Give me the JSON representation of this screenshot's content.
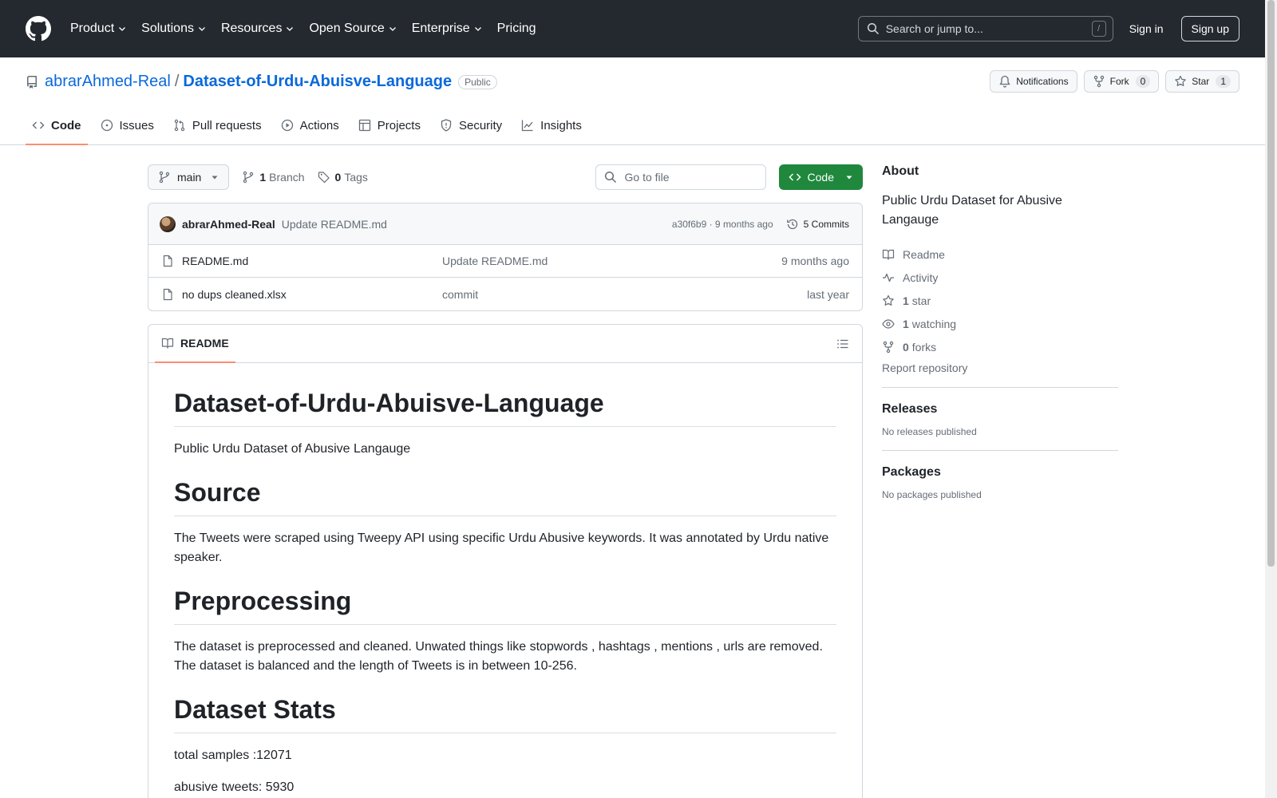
{
  "header": {
    "nav": [
      {
        "label": "Product",
        "has_menu": true
      },
      {
        "label": "Solutions",
        "has_menu": true
      },
      {
        "label": "Resources",
        "has_menu": true
      },
      {
        "label": "Open Source",
        "has_menu": true
      },
      {
        "label": "Enterprise",
        "has_menu": true
      },
      {
        "label": "Pricing",
        "has_menu": false
      }
    ],
    "search_placeholder": "Search or jump to...",
    "search_shortcut": "/",
    "sign_in": "Sign in",
    "sign_up": "Sign up"
  },
  "repo": {
    "owner": "abrarAhmed-Real",
    "separator": "/",
    "name": "Dataset-of-Urdu-Abuisve-Language",
    "visibility": "Public",
    "notifications_label": "Notifications",
    "fork_label": "Fork",
    "fork_count": "0",
    "star_label": "Star",
    "star_count": "1"
  },
  "tabs": [
    {
      "label": "Code",
      "icon": "code-icon",
      "active": true
    },
    {
      "label": "Issues",
      "icon": "issue-icon",
      "active": false
    },
    {
      "label": "Pull requests",
      "icon": "pull-request-icon",
      "active": false
    },
    {
      "label": "Actions",
      "icon": "play-icon",
      "active": false
    },
    {
      "label": "Projects",
      "icon": "table-icon",
      "active": false
    },
    {
      "label": "Security",
      "icon": "shield-icon",
      "active": false
    },
    {
      "label": "Insights",
      "icon": "graph-icon",
      "active": false
    }
  ],
  "file_nav": {
    "branch": "main",
    "branch_count": "1",
    "branch_label": "Branch",
    "tag_count": "0",
    "tag_label": "Tags",
    "goto_placeholder": "Go to file",
    "code_button": "Code"
  },
  "latest_commit": {
    "author": "abrarAhmed-Real",
    "message": "Update README.md",
    "meta": "a30f6b9 · 9 months ago",
    "commits_label": "5 Commits"
  },
  "files": [
    {
      "name": "README.md",
      "commit": "Update README.md",
      "date": "9 months ago"
    },
    {
      "name": "no dups cleaned.xlsx",
      "commit": "commit",
      "date": "last year"
    }
  ],
  "readme": {
    "tab_label": "README",
    "title": "Dataset-of-Urdu-Abuisve-Language",
    "intro": "Public Urdu Dataset of Abusive Langauge",
    "source_heading": "Source",
    "source_text": "The Tweets were scraped using Tweepy API using specific Urdu Abusive keywords. It was annotated by Urdu native speaker.",
    "prep_heading": "Preprocessing",
    "prep_text": "The dataset is preprocessed and cleaned. Unwated things like stopwords , hashtags , mentions , urls are removed. The dataset is balanced and the length of Tweets is in between 10-256.",
    "stats_heading": "Dataset Stats",
    "stats_total": "total samples :12071",
    "stats_abusive": "abusive tweets: 5930"
  },
  "about": {
    "heading": "About",
    "description": "Public Urdu Dataset for Abusive Langauge",
    "readme": "Readme",
    "activity": "Activity",
    "stars_count": "1",
    "stars_label": "star",
    "watching_count": "1",
    "watching_label": "watching",
    "forks_count": "0",
    "forks_label": "forks",
    "report": "Report repository"
  },
  "releases": {
    "heading": "Releases",
    "empty": "No releases published"
  },
  "packages": {
    "heading": "Packages",
    "empty": "No packages published"
  },
  "colors": {
    "header_bg": "#24292f",
    "link": "#0969da",
    "green": "#1f883d",
    "tab_underline": "#fd8c73"
  }
}
